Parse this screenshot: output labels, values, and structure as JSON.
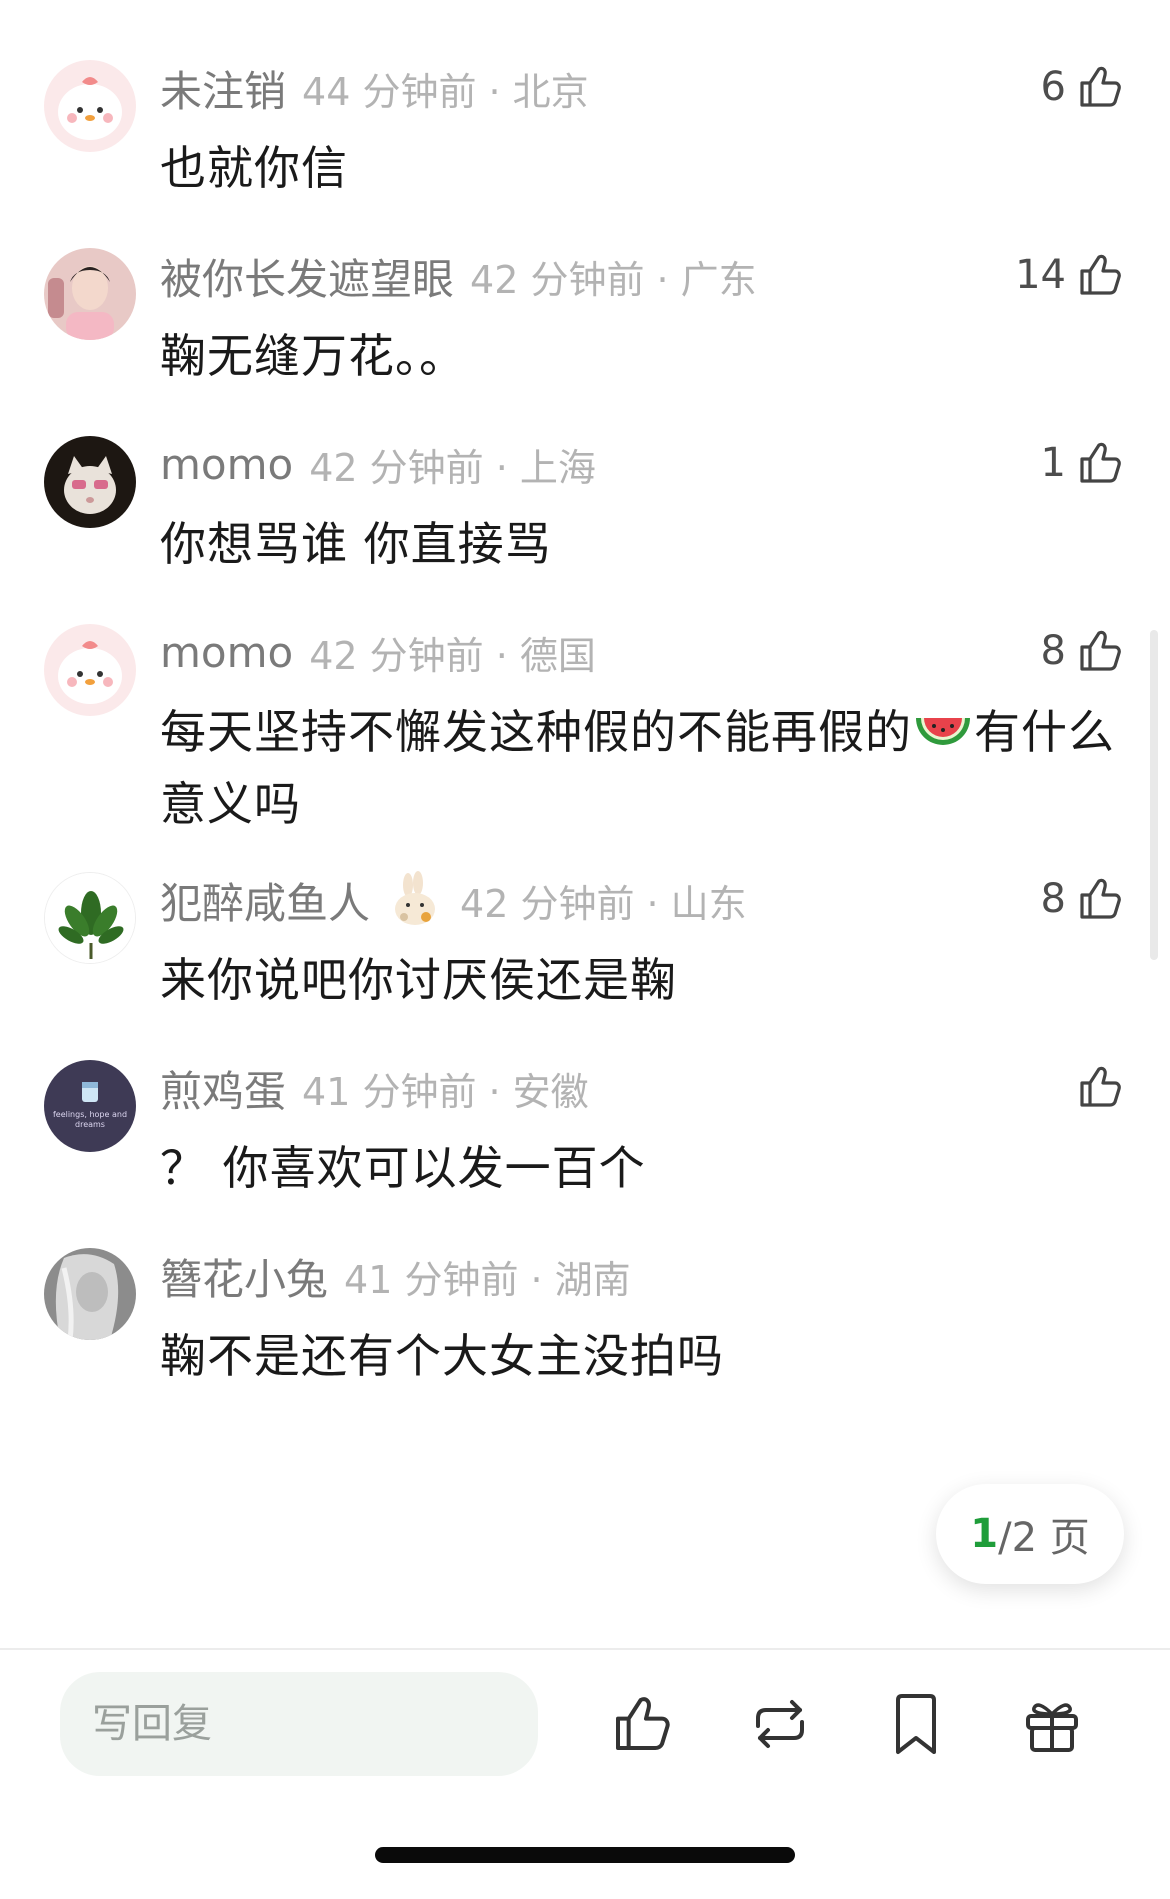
{
  "comments": [
    {
      "username": "未注销",
      "meta": "44 分钟前 · 北京",
      "likes": "6",
      "text": "也就你信",
      "avatar": "pink-chick-avatar"
    },
    {
      "username": "被你长发遮望眼",
      "meta": "42 分钟前 · 广东",
      "likes": "14",
      "text": "鞠无缝万花。。",
      "avatar": "person-portrait-avatar"
    },
    {
      "username": "momo",
      "meta": "42 分钟前 · 上海",
      "likes": "1",
      "text": "你想骂谁 你直接骂",
      "avatar": "cat-with-sunglasses-avatar"
    },
    {
      "username": "momo",
      "meta": "42 分钟前 · 德国",
      "likes": "8",
      "text_before": "每天坚持不懈发这种假的不能再假的",
      "text_after": "有什么意义吗",
      "inline_emoji": "watermelon-icon",
      "avatar": "pink-chick-avatar"
    },
    {
      "username": "犯醉咸鱼人",
      "meta": "42 分钟前 · 山东",
      "likes": "8",
      "text": "来你说吧你讨厌侯还是鞠",
      "badge": "rabbit-badge-icon",
      "avatar": "green-leaves-avatar"
    },
    {
      "username": "煎鸡蛋",
      "meta": "41 分钟前 · 安徽",
      "likes": "",
      "text": "？ 你喜欢可以发一百个",
      "avatar": "dark-purple-avatar",
      "avatar_text": "feelings, hope and dreams"
    },
    {
      "username": "簪花小兔",
      "meta": "41 分钟前 · 湖南",
      "likes": "",
      "text": "鞠不是还有个大女主没拍吗",
      "avatar": "grayscale-portrait-avatar"
    }
  ],
  "pager": {
    "current": "1",
    "total": "/2 页"
  },
  "bottom_bar": {
    "reply_placeholder": "写回复",
    "actions": [
      "thumbs-up-icon",
      "repost-icon",
      "bookmark-icon",
      "gift-icon"
    ]
  },
  "colors": {
    "username": "#7a7a7a",
    "meta": "#b3b3b3",
    "pager_current": "#1f9d3a",
    "reply_bg": "#f1f5f2"
  }
}
